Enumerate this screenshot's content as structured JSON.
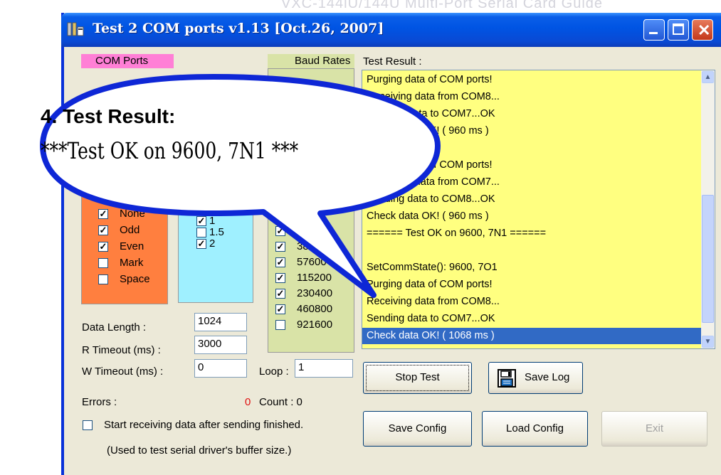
{
  "background_text": "VXC-144iU/144U Multi-Port Serial Card Guide",
  "window": {
    "title": "Test 2 COM ports v1.13 [Oct.26, 2007]",
    "accent": "#0054e3"
  },
  "groups": {
    "com_ports_label": "COM Ports",
    "baud_rates_label": "Baud Rates",
    "test_result_label": "Test Result :"
  },
  "parity": {
    "items": [
      {
        "label": "None",
        "checked": true
      },
      {
        "label": "Odd",
        "checked": true
      },
      {
        "label": "Even",
        "checked": true
      },
      {
        "label": "Mark",
        "checked": false
      },
      {
        "label": "Space",
        "checked": false
      }
    ]
  },
  "stop_bits": {
    "items": [
      {
        "label": "1",
        "checked": true
      },
      {
        "label": "1.5",
        "checked": false
      },
      {
        "label": "2",
        "checked": true
      }
    ]
  },
  "baud_rates": {
    "items": [
      {
        "label": "",
        "checked": true
      },
      {
        "label": "38400",
        "checked": true
      },
      {
        "label": "57600",
        "checked": true
      },
      {
        "label": "115200",
        "checked": true
      },
      {
        "label": "230400",
        "checked": true
      },
      {
        "label": "460800",
        "checked": true
      },
      {
        "label": "921600",
        "checked": false
      }
    ]
  },
  "fields": {
    "data_length_label": "Data Length :",
    "data_length_value": "1024",
    "r_timeout_label": "R Timeout (ms) :",
    "r_timeout_value": "3000",
    "w_timeout_label": "W Timeout (ms) :",
    "w_timeout_value": "0",
    "loop_label": "Loop :",
    "loop_value": "1",
    "errors_label": "Errors :",
    "errors_value": "0",
    "count_label": "Count : 0"
  },
  "options": {
    "start_receiving_label": "Start receiving data after sending finished.",
    "start_receiving_checked": false,
    "note": "(Used to test serial driver's buffer size.)"
  },
  "test_result_lines": [
    "Purging data of COM ports!",
    "Receiving data from COM8...",
    "Sending data to COM7...OK",
    "Check data OK! ( 960 ms )",
    "",
    "Purging data of COM ports!",
    "Receiving data from COM7...",
    "Sending data to COM8...OK",
    "Check data OK! ( 960 ms )",
    "====== Test OK on 9600, 7N1 ======",
    "",
    "SetCommState(): 9600, 7O1",
    "Purging data of COM ports!",
    "Receiving data from COM8...",
    "Sending data to COM7...OK",
    "Check data OK! ( 1068 ms )"
  ],
  "buttons": {
    "stop_test": "Stop Test",
    "save_log": "Save Log",
    "save_config": "Save Config",
    "load_config": "Load Config",
    "exit": "Exit"
  },
  "callout": {
    "title": "4. Test Result:",
    "message": "***Test OK on 9600, 7N1 ***"
  },
  "colors": {
    "result_bg": "#ffff80",
    "parity_bg": "#ff7f3f",
    "stopbits_bg": "#9ff0ff",
    "baud_bg": "#d9e3a7",
    "com_label_bg": "#ff7fd6",
    "selected_line": "#316ac5",
    "callout_border": "#0e27d6"
  }
}
